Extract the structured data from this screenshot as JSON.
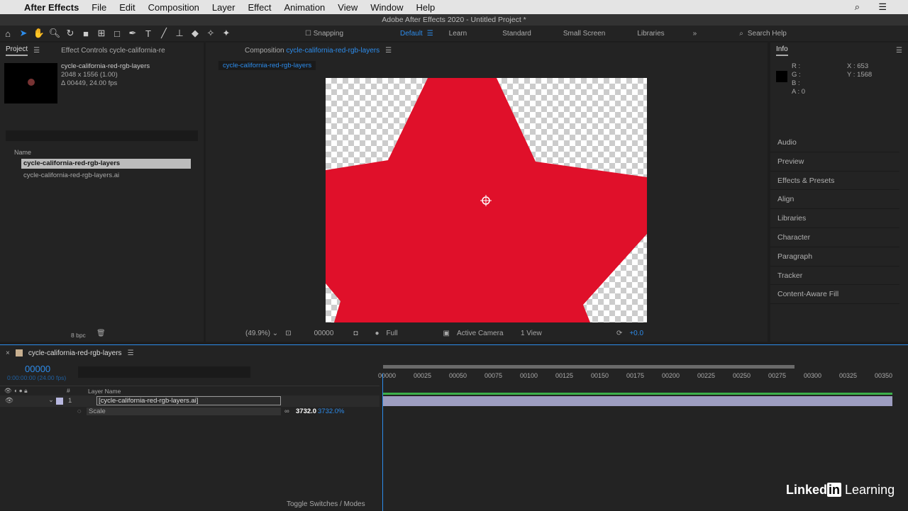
{
  "menubar": {
    "app": "After Effects",
    "items": [
      "File",
      "Edit",
      "Composition",
      "Layer",
      "Effect",
      "Animation",
      "View",
      "Window",
      "Help"
    ]
  },
  "titlebar": "Adobe After Effects 2020 - Untitled Project *",
  "toolbar": {
    "snapping": "Snapping",
    "workspaces": [
      "Default",
      "Learn",
      "Standard",
      "Small Screen",
      "Libraries"
    ],
    "search": "Search Help"
  },
  "project": {
    "tab": "Project",
    "effect_tab": "Effect Controls cycle-california-re",
    "item_name": "cycle-california-red-rgb-layers",
    "dims": "2048 x 1556 (1.00)",
    "duration": "Δ 00449, 24.00 fps",
    "col_name": "Name",
    "items": [
      "cycle-california-red-rgb-layers",
      "cycle-california-red-rgb-layers.ai"
    ],
    "bpc": "8 bpc"
  },
  "comp": {
    "tab_prefix": "Composition",
    "tab_name": "cycle-california-red-rgb-layers",
    "breadcrumb": "cycle-california-red-rgb-layers",
    "zoom": "(49.9%)",
    "time": "00000",
    "resolution": "Full",
    "camera": "Active Camera",
    "views": "1 View",
    "exposure": "+0.0"
  },
  "info": {
    "tab": "Info",
    "r": "R :",
    "g": "G :",
    "b": "B :",
    "a": "A : 0",
    "x": "X : 653",
    "y": "Y : 1568",
    "panels": [
      "Audio",
      "Preview",
      "Effects & Presets",
      "Align",
      "Libraries",
      "Character",
      "Paragraph",
      "Tracker",
      "Content-Aware Fill"
    ]
  },
  "timeline": {
    "tab": "cycle-california-red-rgb-layers",
    "timecode": "00000",
    "timecode_sub": "0:00:00:00 (24.00 fps)",
    "col_layer": "Layer Name",
    "col_num": "#",
    "layer_num": "1",
    "layer_name": "[cycle-california-red-rgb-layers.ai]",
    "prop": "Scale",
    "scale_x": "3732.0",
    "scale_y": "3732.0%",
    "ticks": [
      "00000",
      "00025",
      "00050",
      "00075",
      "00100",
      "00125",
      "00150",
      "00175",
      "00200",
      "00225",
      "00250",
      "00275",
      "00300",
      "00325",
      "00350"
    ],
    "toggle": "Toggle Switches / Modes"
  },
  "branding": "LinkedIn Learning",
  "colors": {
    "accent": "#2d8ceb",
    "star": "#e0102a",
    "layer_bar": "#9d9dc0"
  }
}
